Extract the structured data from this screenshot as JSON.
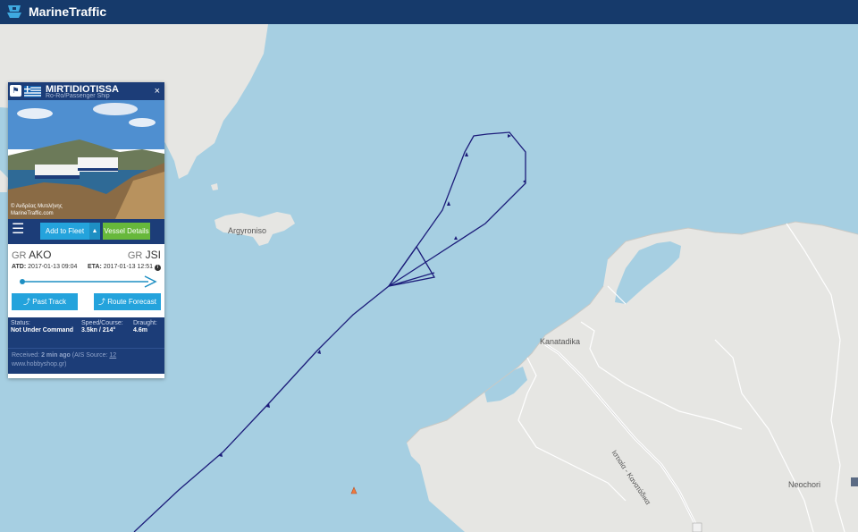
{
  "app": {
    "brand": "MarineTraffic"
  },
  "map": {
    "places": [
      "Argyroniso",
      "Kanatadika",
      "Neochori",
      "Ιστιαία - Κανατάδικα"
    ],
    "colors": {
      "sea": "#a6cfe2",
      "land": "#e6e6e3",
      "track": "#1c1c7a",
      "vessel": "#f07a3c"
    }
  },
  "vessel": {
    "name": "MIRTIDIOTISSA",
    "type": "Ro-Ro/Passenger Ship",
    "photo_credit_1": "© Ανδρέας Μυτιλήνης",
    "photo_credit_2": "MarineTraffic.com",
    "close": "×",
    "add_to_fleet": "Add to Fleet",
    "vessel_details": "Vessel Details",
    "from_country": "GR",
    "from_port": "AKO",
    "to_country": "GR",
    "to_port": "JSI",
    "atd_label": "ATD:",
    "atd_value": "2017-01-13 09:04",
    "eta_label": "ETA:",
    "eta_value": "2017-01-13 12:51",
    "voyage_progress": 1.0,
    "past_track": "Past Track",
    "route_forecast": "Route Forecast",
    "status_label": "Status:",
    "status_value": "Not Under Command",
    "speed_label": "Speed/Course:",
    "speed_value": "3.5kn / 214°",
    "draught_label": "Draught:",
    "draught_value": "4.6m",
    "received_label": "Received:",
    "received_value": "2 min ago",
    "ais_prefix": "(AIS Source:",
    "ais_id": "12",
    "ais_source": "www.hobbyshop.gr)"
  }
}
